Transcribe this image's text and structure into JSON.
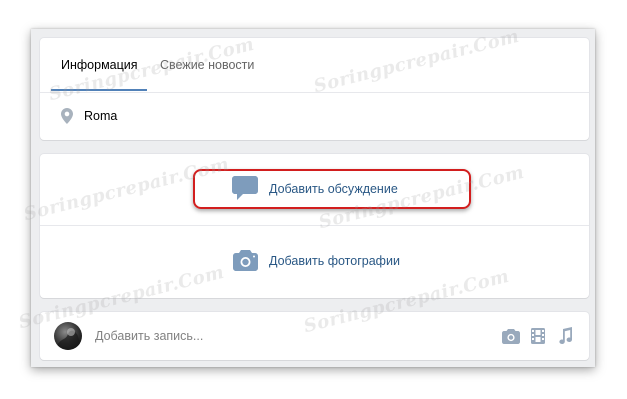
{
  "tabs": [
    {
      "label": "Информация",
      "active": true
    },
    {
      "label": "Свежие новости",
      "active": false
    }
  ],
  "location": {
    "icon": "map-pin-icon",
    "text": "Roma"
  },
  "actions": {
    "discussion": {
      "icon": "discussion-bubble-icon",
      "label": "Добавить обсуждение"
    },
    "photos": {
      "icon": "camera-icon",
      "label": "Добавить фотографии"
    }
  },
  "post": {
    "placeholder": "Добавить запись...",
    "tools": [
      "camera-icon",
      "video-film-icon",
      "music-note-icon"
    ]
  },
  "watermark": "Soringpcrepair.Com",
  "colors": {
    "background": "#edeef0",
    "accent": "#5181b8",
    "link": "#2a5885",
    "icon": "#7e9cbc",
    "highlight": "#d21e1e"
  }
}
